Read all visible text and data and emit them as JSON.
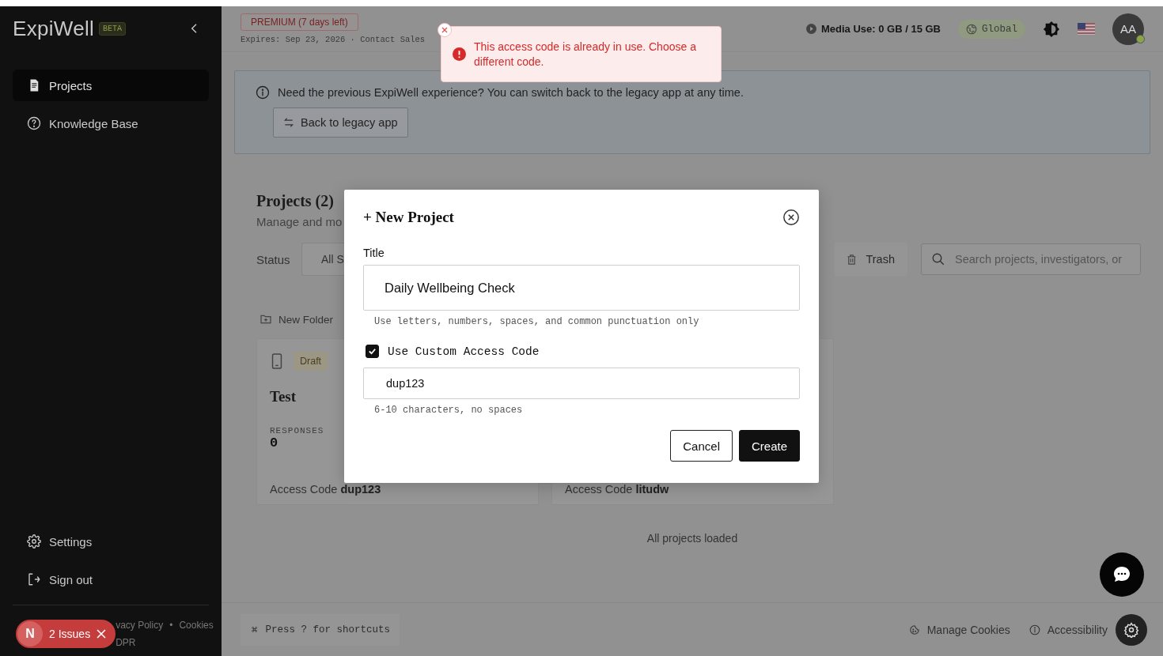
{
  "sidebar": {
    "logo": "ExpiWell",
    "badge": "BETA",
    "items": [
      {
        "label": "Projects",
        "selected": true
      },
      {
        "label": "Knowledge Base",
        "selected": false
      }
    ],
    "bottom_items": [
      {
        "label": "Settings"
      },
      {
        "label": "Sign out"
      }
    ],
    "footer_links": [
      "vacy Policy",
      "Cookies"
    ],
    "footer_separator": "•",
    "footer_line_2": "DPR"
  },
  "issues_badge": {
    "letter": "N",
    "label": "2 Issues"
  },
  "header": {
    "plan": "PREMIUM (7 days left)",
    "expires": "Expires: Sep 23, 2026 · Contact Sales",
    "media_use": "Media Use: 0 GB / 15 GB",
    "region": "Global",
    "avatar": "AA",
    "online": true
  },
  "toast": {
    "message": "This access code is already in use. Choose a different code."
  },
  "banner": {
    "text": "Need the previous ExpiWell experience? You can switch back to the legacy app at any time.",
    "button": "Back to legacy app"
  },
  "projects": {
    "title": "Projects (2)",
    "subtitle": "Manage and mo",
    "status_label": "Status",
    "status_value": "All S",
    "trash": "Trash",
    "search_placeholder": "Search projects, investigators, or",
    "new_folder": "New Folder",
    "cards": [
      {
        "status": "Draft",
        "title": "Test",
        "responses_label": "RESPONSES",
        "responses": "0",
        "access": "Access Code **dup123**"
      },
      {
        "access": "Access Code **litudw**"
      }
    ],
    "loaded": "All projects loaded"
  },
  "modal": {
    "title": "+ New Project",
    "title_label": "Title",
    "title_value": "Daily Wellbeing Check",
    "title_hint": "Use letters, numbers, spaces, and common punctuation only",
    "custom_code": {
      "label": "Use Custom Access Code",
      "checked": true
    },
    "code_value": "dup123",
    "code_hint": "6-10 characters, no spaces",
    "buttons": [
      {
        "label": "Cancel",
        "kind": "secondary"
      },
      {
        "label": "Create",
        "kind": "primary"
      }
    ]
  },
  "footer": {
    "shortcut_key": "⌘",
    "shortcut": "Press ? for shortcuts",
    "links": [
      {
        "label": "Manage Cookies"
      },
      {
        "label": "Accessibility"
      }
    ]
  }
}
